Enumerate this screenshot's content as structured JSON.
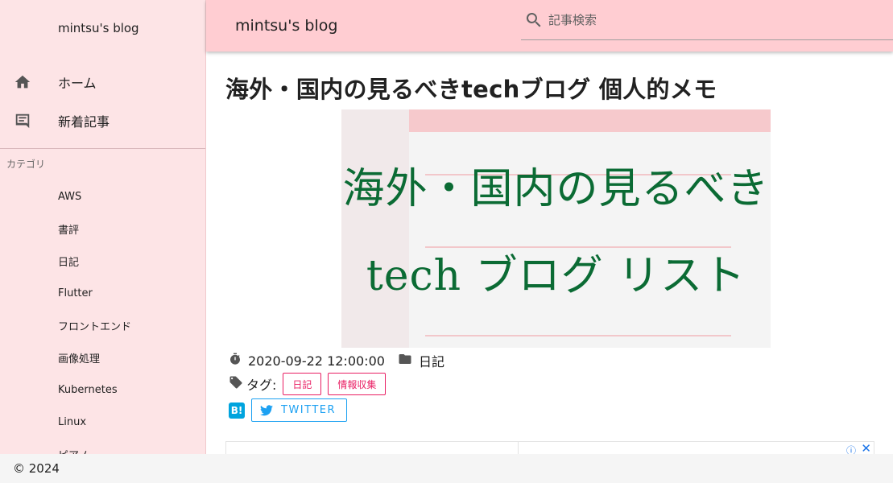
{
  "sidebar": {
    "title": "mintsu's blog",
    "nav": [
      {
        "label": "ホーム",
        "icon": "home-icon"
      },
      {
        "label": "新着記事",
        "icon": "comment-icon"
      }
    ],
    "category_header": "カテゴリ",
    "categories": [
      "AWS",
      "書評",
      "日記",
      "Flutter",
      "フロントエンド",
      "画像処理",
      "Kubernetes",
      "Linux",
      "ピアノ"
    ]
  },
  "topbar": {
    "title": "mintsu's blog",
    "search_placeholder": "記事検索"
  },
  "post": {
    "title": "海外・国内の見るべきtechブログ 個人的メモ",
    "hero_line1": "海外・国内の見るべき",
    "hero_line2": "tech ブログ リスト",
    "date": "2020-09-22 12:00:00",
    "category": "日記",
    "tags_label": "タグ:",
    "tags": [
      "日記",
      "情報収集"
    ],
    "hatena_label": "B!",
    "twitter_label": "TWITTER"
  },
  "ad": {
    "info_icon": "ⓘ",
    "close_icon": "✕"
  },
  "footer": {
    "copyright": "© 2024"
  },
  "colors": {
    "sidebar_bg": "#fde4e6",
    "topbar_bg": "#ffcdd2",
    "tag_accent": "#e91e63",
    "twitter": "#1da1f2",
    "hatena": "#00a4de",
    "hero_text": "#0b6b34"
  }
}
